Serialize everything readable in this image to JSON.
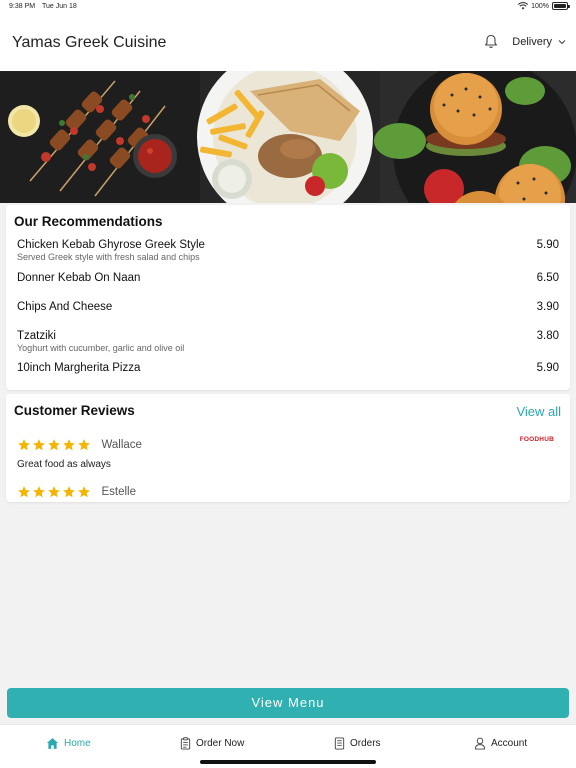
{
  "status_bar": {
    "time": "9:38 PM",
    "date": "Tue Jun 18",
    "battery": "100%"
  },
  "header": {
    "title": "Yamas Greek Cuisine",
    "delivery_label": "Delivery"
  },
  "recommendations": {
    "title": "Our Recommendations",
    "items": [
      {
        "name": "Chicken Kebab Ghyrose Greek Style",
        "description": "Served Greek style with fresh salad and chips",
        "price": "5.90"
      },
      {
        "name": "Donner Kebab On Naan",
        "description": "",
        "price": "6.50"
      },
      {
        "name": "Chips And Cheese",
        "description": "",
        "price": "3.90"
      },
      {
        "name": "Tzatziki",
        "description": "Yoghurt with cucumber, garlic and olive oil",
        "price": "3.80"
      },
      {
        "name": "10inch Margherita Pizza",
        "description": "",
        "price": "5.90"
      }
    ]
  },
  "reviews": {
    "title": "Customer Reviews",
    "view_all": "View all",
    "source": "FOODHUB",
    "items": [
      {
        "name": "Wallace",
        "rating": 5,
        "text": "Great food as always"
      },
      {
        "name": "Estelle",
        "rating": 5,
        "text": ""
      }
    ]
  },
  "view_menu_label": "View Menu",
  "tabs": [
    {
      "label": "Home",
      "active": true
    },
    {
      "label": "Order Now",
      "active": false
    },
    {
      "label": "Orders",
      "active": false
    },
    {
      "label": "Account",
      "active": false
    }
  ],
  "colors": {
    "accent": "#2aa8b0",
    "button": "#30b0b0",
    "star": "#f5b400"
  }
}
